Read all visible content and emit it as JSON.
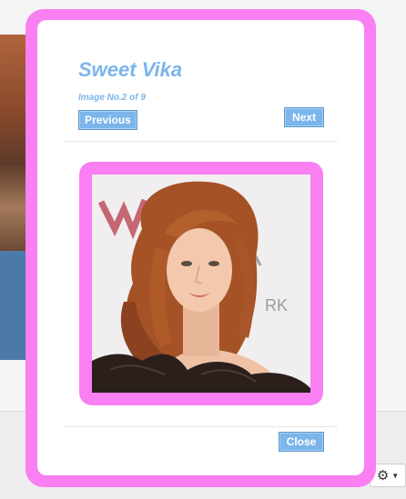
{
  "modal": {
    "title": "Sweet Vika",
    "counter": "Image No.2 of 9",
    "buttons": {
      "previous": "Previous",
      "next": "Next",
      "close": "Close"
    },
    "photo_alt": "Portrait photo of a woman with long auburn hair"
  },
  "background": {
    "settings_icon": "gear-icon"
  },
  "colors": {
    "accent_pink": "#f97ff2",
    "accent_blue": "#7bb5ea"
  }
}
